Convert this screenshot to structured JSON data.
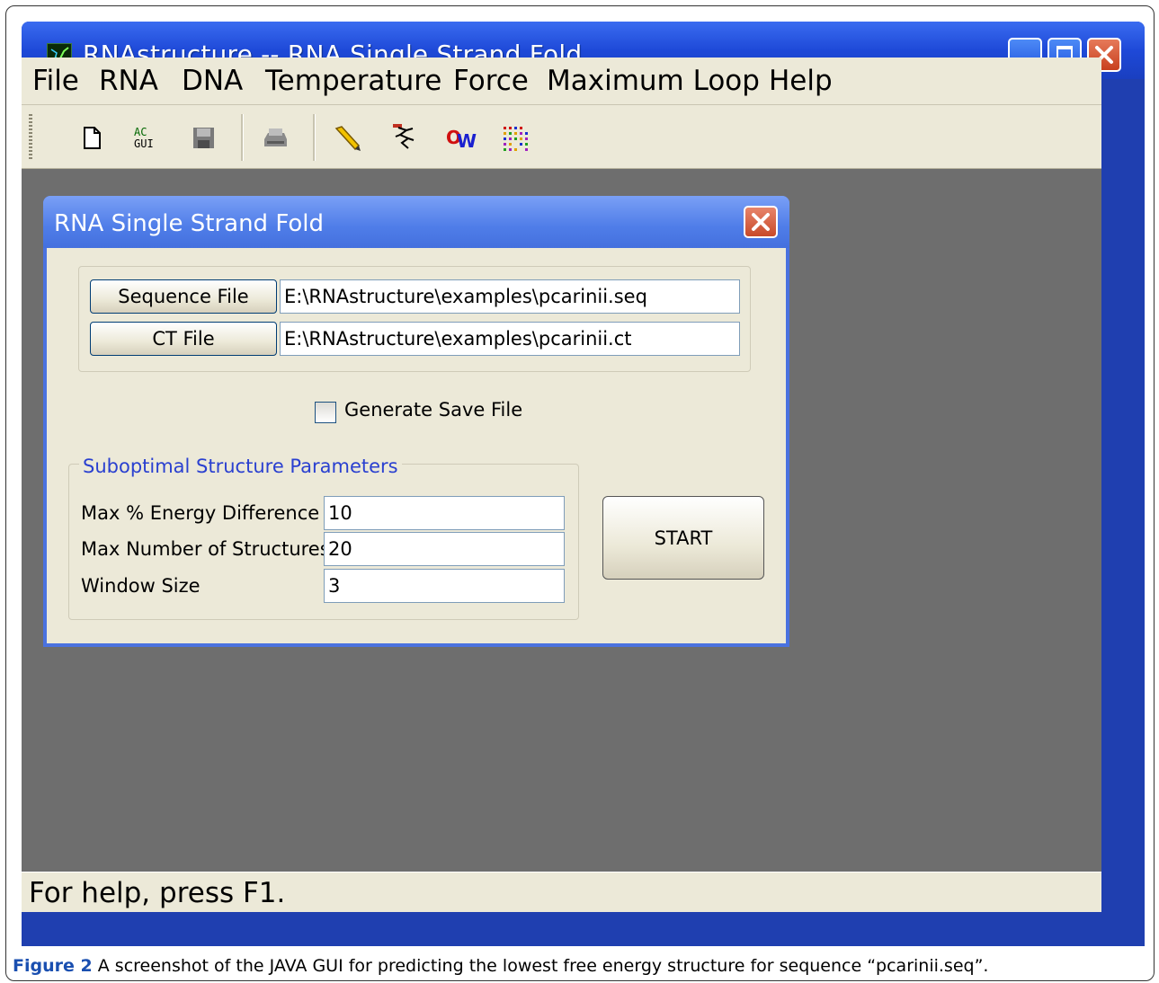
{
  "window": {
    "title": "RNAstructure -- RNA Single Strand Fold",
    "buttons": [
      "minimize",
      "maximize",
      "close"
    ]
  },
  "menubar": {
    "items": [
      "File",
      "RNA",
      "DNA",
      "Temperature",
      "Force",
      "Maximum Loop",
      "Help"
    ]
  },
  "toolbar": {
    "icons": [
      "new-file-icon",
      "sequence-gui-icon",
      "save-disk-icon",
      "print-icon",
      "pencil-icon",
      "draw-structure-icon",
      "oligowalk-icon",
      "dot-plot-icon"
    ]
  },
  "dialog": {
    "title": "RNA Single Strand Fold",
    "sequence_file": {
      "button_label": "Sequence File",
      "value": "E:\\RNAstructure\\examples\\pcarinii.seq"
    },
    "ct_file": {
      "button_label": "CT File",
      "value": "E:\\RNAstructure\\examples\\pcarinii.ct"
    },
    "generate_save_file": {
      "label": "Generate Save File",
      "checked": false
    },
    "suboptimal": {
      "legend": "Suboptimal Structure Parameters",
      "max_energy_label": "Max % Energy Difference",
      "max_energy_value": "10",
      "max_structures_label": "Max Number of Structures",
      "max_structures_value": "20",
      "window_size_label": "Window Size",
      "window_size_value": "3"
    },
    "start_label": "START"
  },
  "statusbar": {
    "text": "For help, press F1."
  },
  "caption": {
    "label": "Figure 2",
    "text": " A screenshot of the JAVA GUI for predicting the lowest free energy structure for sequence “pcarinii.seq”."
  },
  "colors": {
    "titlebar": "#1e49d8",
    "dialog_titlebar": "#4f7de8",
    "chrome": "#ece9d8",
    "mdi_background": "#6e6e6e",
    "legend_text": "#2a40d0",
    "caption_label": "#1a4fb0"
  }
}
